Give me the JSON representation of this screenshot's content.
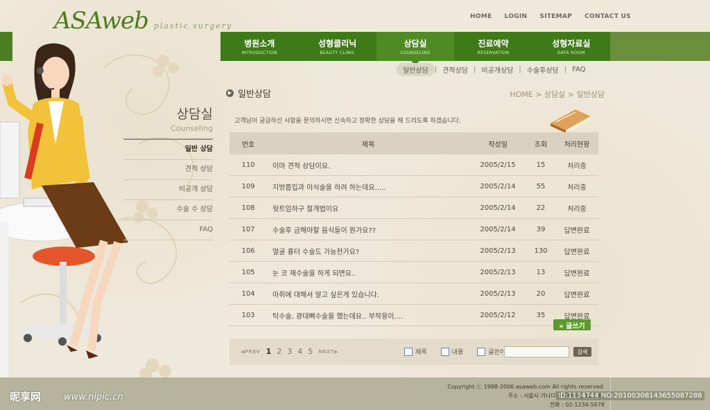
{
  "logo": {
    "brand": "ASAweb",
    "tagline": "plastic surgery"
  },
  "toplinks": [
    "HOME",
    "LOGIN",
    "SITEMAP",
    "CONTACT US"
  ],
  "nav": [
    {
      "ko": "병원소개",
      "en": "INTRODUCTION"
    },
    {
      "ko": "성형클리닉",
      "en": "BEAUTY CLINIC"
    },
    {
      "ko": "상담실",
      "en": "COUNSELING"
    },
    {
      "ko": "진료예약",
      "en": "RESERVATION"
    },
    {
      "ko": "성형자료실",
      "en": "DATA ROOM"
    }
  ],
  "subnav": [
    "일반상담",
    "견적상담",
    "비공개상담",
    "수술후상담",
    "FAQ"
  ],
  "side": {
    "title": "상담실",
    "title_en": "Counseling",
    "menu": [
      "일반 상담",
      "견적 상담",
      "비공개 상담",
      "수술 수 상담",
      "FAQ"
    ]
  },
  "page": {
    "title": "일반상담",
    "breadcrumb": "HOME > 상담실 > 일반상담",
    "intro": "고객님이 궁금하신 사항을 문의하시면 신속하고 정확한 상담을 해 드리도록 하겠습니다."
  },
  "table": {
    "headers": [
      "번호",
      "제목",
      "작성일",
      "조회",
      "처리현황"
    ],
    "rows": [
      [
        "110",
        "이마 견적 상담이요.",
        "2005/2/15",
        "15",
        "처리중"
      ],
      [
        "109",
        "지방흡입과 이식술을 하려 하는데요.....",
        "2005/2/14",
        "55",
        "처리중"
      ],
      [
        "108",
        "뒷트임하구 절개법이요",
        "2005/2/14",
        "22",
        "처리중"
      ],
      [
        "107",
        "수술후 금해야할 음식들이 뭔가요??",
        "2005/2/14",
        "39",
        "답변완료"
      ],
      [
        "106",
        "얼굴 흉터 수술도 가능한가요?",
        "2005/2/13",
        "130",
        "답변완료"
      ],
      [
        "105",
        "눈 코 재수술을 하게 되면요..",
        "2005/2/13",
        "13",
        "답변완료"
      ],
      [
        "104",
        "마취에 대해서 알고 싶은게 있습니다.",
        "2005/2/13",
        "20",
        "답변완료"
      ],
      [
        "103",
        "턱수술, 광대뼈수술을 했는데요.. 부작용이....",
        "2005/2/12",
        "35",
        "답변완료"
      ]
    ]
  },
  "write_button": "» 글쓰기",
  "pager": {
    "prev": "◀PREV",
    "pages": [
      "1",
      "2",
      "3",
      "4",
      "5"
    ],
    "current": "1",
    "next": "NEXT▶"
  },
  "search": {
    "options": [
      "제목",
      "내용",
      "글쓴이"
    ],
    "button": "검색"
  },
  "footer": {
    "copyright": "Copyright ⓒ 1998-2006 asaweb.com All rights reserved.",
    "address": "주소 : 서울시 가나다구 라마사동 123-45",
    "phone": "전화 : 02-1234-5678"
  },
  "watermark": {
    "site": "昵享网",
    "url": "www.nipic.cn",
    "id": "ID:1134744 NO:20100308143655087288"
  },
  "colors": {
    "green": "#3f7a18",
    "bg": "#efe9dc",
    "footer": "#b6b49c"
  }
}
